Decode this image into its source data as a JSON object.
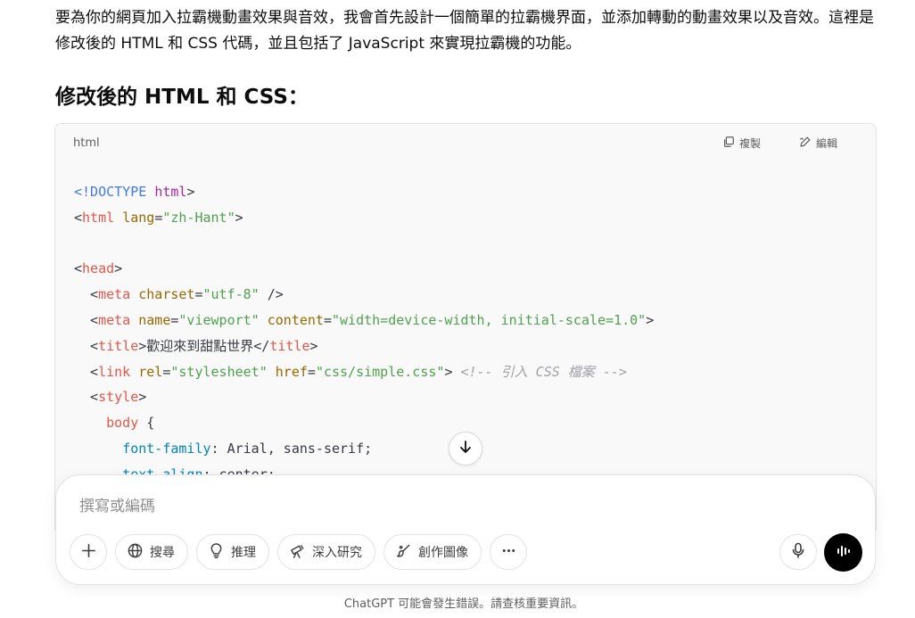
{
  "message": {
    "intro": "要為你的網頁加入拉霸機動畫效果與音效，我會首先設計一個簡單的拉霸機界面，並添加轉動的動畫效果以及音效。這裡是修改後的 HTML 和 CSS 代碼，並且包括了 JavaScript 來實現拉霸機的功能。",
    "section_title": "修改後的 HTML 和 CSS："
  },
  "code_block": {
    "language": "html",
    "copy_label": "複製",
    "edit_label": "編輯",
    "lines": [
      "<!DOCTYPE html>",
      "<html lang=\"zh-Hant\">",
      "",
      "<head>",
      "  <meta charset=\"utf-8\" />",
      "  <meta name=\"viewport\" content=\"width=device-width, initial-scale=1.0\">",
      "  <title>歡迎來到甜點世界</title>",
      "  <link rel=\"stylesheet\" href=\"css/simple.css\"> <!-- 引入 CSS 檔案 -->",
      "  <style>",
      "    body {",
      "      font-family: Arial, sans-serif;",
      "      text-align: center;"
    ]
  },
  "composer": {
    "placeholder": "撰寫或編碼",
    "tools": [
      {
        "icon": "globe-icon",
        "label": "搜尋"
      },
      {
        "icon": "lightbulb-icon",
        "label": "推理"
      },
      {
        "icon": "telescope-icon",
        "label": "深入研究"
      },
      {
        "icon": "paint-brush-icon",
        "label": "創作圖像"
      }
    ]
  },
  "disclaimer": "ChatGPT 可能會發生錯誤。請查核重要資訊。",
  "colors": {
    "code_background": "#f9f9f9",
    "tag": "#e45649",
    "attribute": "#986801",
    "string": "#50a14f",
    "comment": "#a0a1a7",
    "voice_button": "#000000"
  }
}
